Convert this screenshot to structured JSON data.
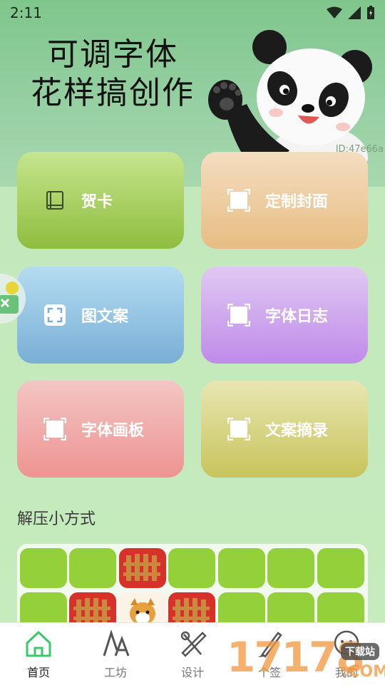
{
  "status_bar": {
    "time": "2:11"
  },
  "hero": {
    "title_line1": "可调字体",
    "title_line2": "花样搞创作",
    "id_tag": "ID:47e66a"
  },
  "cards": {
    "greeting": "贺卡",
    "cover": "定制封面",
    "picture_text": "图文案",
    "diary": "字体日志",
    "canvas": "字体画板",
    "excerpt": "文案摘录"
  },
  "section": {
    "title": "解压小方式"
  },
  "tabs": [
    {
      "label": "首页",
      "icon": "home-icon"
    },
    {
      "label": "工坊",
      "icon": "font-icon"
    },
    {
      "label": "设计",
      "icon": "design-icon"
    },
    {
      "label": "个签",
      "icon": "pen-icon"
    },
    {
      "label": "我的",
      "icon": "profile-icon"
    }
  ],
  "watermark": {
    "text": "17178",
    "badge": "下载站",
    "suffix": ".COM"
  },
  "colors": {
    "accent": "#3cc86a",
    "tile_green": "#93d03a",
    "tile_red": "#d7322a"
  }
}
